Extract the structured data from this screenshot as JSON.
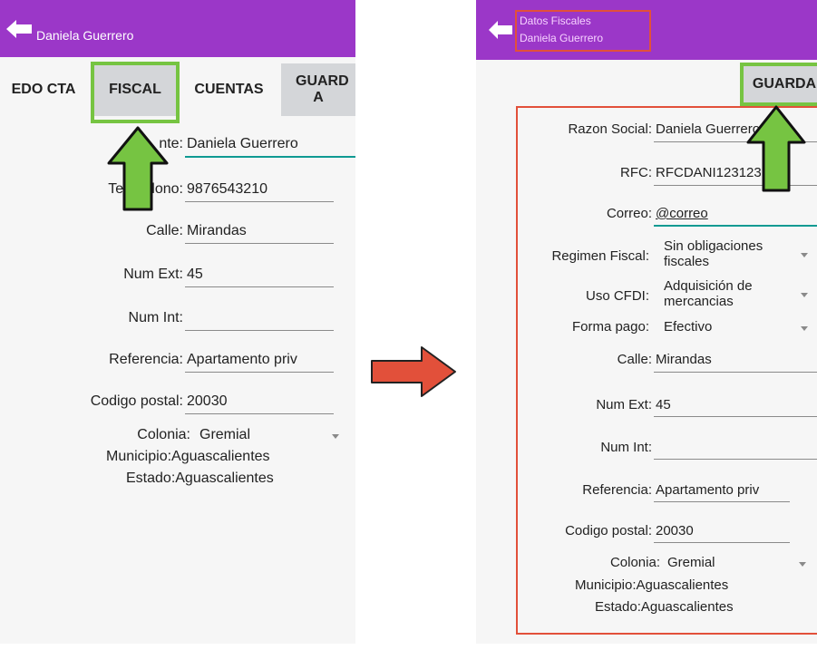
{
  "left": {
    "title": "Daniela Guerrero",
    "tabs": {
      "edo_cta": "EDO CTA",
      "fiscal": "FISCAL",
      "cuentas": "CUENTAS",
      "guarda": "GUARD A"
    },
    "form": {
      "cliente_label": "nte:",
      "cliente_value": "Daniela Guerrero",
      "telefono_label": "Te       lono:",
      "telefono_value": "9876543210",
      "calle_label": "Calle:",
      "calle_value": "Mirandas",
      "num_ext_label": "Num Ext:",
      "num_ext_value": "45",
      "num_int_label": "Num Int:",
      "num_int_value": "",
      "referencia_label": "Referencia:",
      "referencia_value": "Apartamento priv",
      "codigo_postal_label": "Codigo postal:",
      "codigo_postal_value": "20030",
      "colonia_label": "Colonia:",
      "colonia_value": "Gremial",
      "municipio_text": "Municipio:Aguascalientes",
      "estado_text": "Estado:Aguascalientes"
    }
  },
  "right": {
    "title_line1": "Datos Fiscales",
    "title_line2": "Daniela Guerrero",
    "guarda_label": "GUARDA",
    "form": {
      "razon_label": "Razon Social:",
      "razon_value": "Daniela Guerrero",
      "rfc_label": "RFC:",
      "rfc_value": "RFCDANI123123",
      "correo_label": "Correo:",
      "correo_value": "@correo",
      "regimen_label": "Regimen Fiscal:",
      "regimen_value": "Sin obligaciones fiscales",
      "uso_label": "Uso CFDI:",
      "uso_value": "Adquisición de mercancias",
      "forma_label": "Forma pago:",
      "forma_value": "Efectivo",
      "calle_label": "Calle:",
      "calle_value": "Mirandas",
      "num_ext_label": "Num Ext:",
      "num_ext_value": "45",
      "num_int_label": "Num Int:",
      "num_int_value": "",
      "referencia_label": "Referencia:",
      "referencia_value": "Apartamento priv",
      "codigo_postal_label": "Codigo postal:",
      "codigo_postal_value": "20030",
      "colonia_label": "Colonia:",
      "colonia_value": "Gremial",
      "municipio_text": "Municipio:Aguascalientes",
      "estado_text": "Estado:Aguascalientes"
    }
  },
  "colors": {
    "appbar": "#9b37c8",
    "highlight_green": "#76c442",
    "highlight_red": "#e2503a",
    "arrow_red": "#e2503a",
    "input_focus": "#0f9a92"
  }
}
